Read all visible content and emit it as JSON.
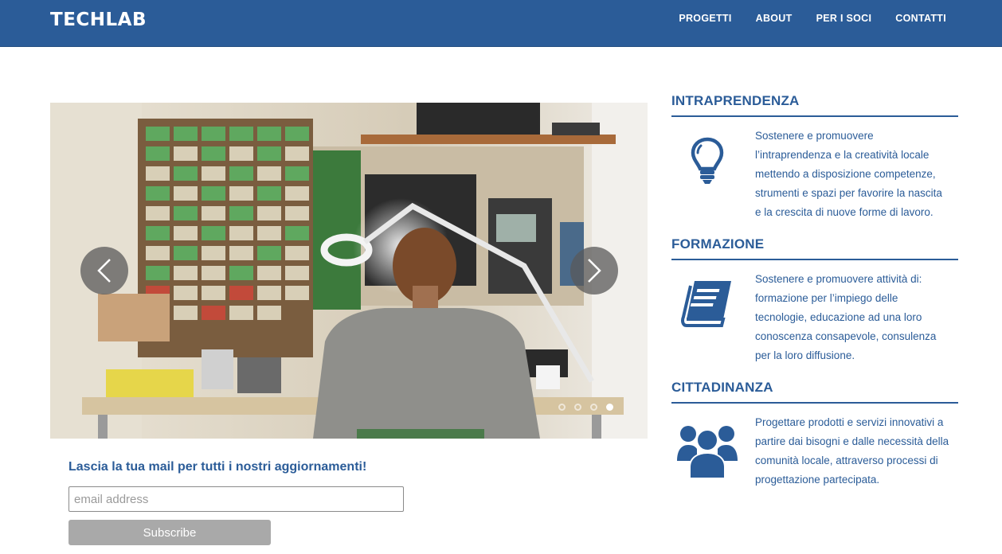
{
  "header": {
    "logo": "TECHLAB",
    "nav": [
      "PROGETTI",
      "ABOUT",
      "PER I SOCI",
      "CONTATTI"
    ]
  },
  "carousel": {
    "prev_icon": "chevron-left-icon",
    "next_icon": "chevron-right-icon",
    "slide_count": 4,
    "active_slide": 4
  },
  "newsletter": {
    "title": "Lascia la tua mail per tutti i nostri aggiornamenti!",
    "placeholder": "email address",
    "value": "",
    "button": "Subscribe"
  },
  "features": [
    {
      "title": "INTRAPRENDENZA",
      "icon": "lightbulb-icon",
      "text": "Sostenere e promuovere l’intraprendenza e la creatività locale mettendo a disposizione competenze, strumenti e spazi per favorire la nascita e la crescita di nuove forme di lavoro."
    },
    {
      "title": "FORMAZIONE",
      "icon": "book-icon",
      "text": "Sostenere e promuovere attività di: formazione per l’impiego delle tecnologie, educazione ad una loro conoscenza consapevole, consulenza per la loro diffusione."
    },
    {
      "title": "CITTADINANZA",
      "icon": "users-icon",
      "text": "Progettare prodotti e servizi innovativi a partire dai bisogni e dalle necessità della comunità locale, attraverso processi di progettazione partecipata."
    }
  ],
  "colors": {
    "brand": "#2b5c98",
    "button": "#a9a9a9"
  }
}
